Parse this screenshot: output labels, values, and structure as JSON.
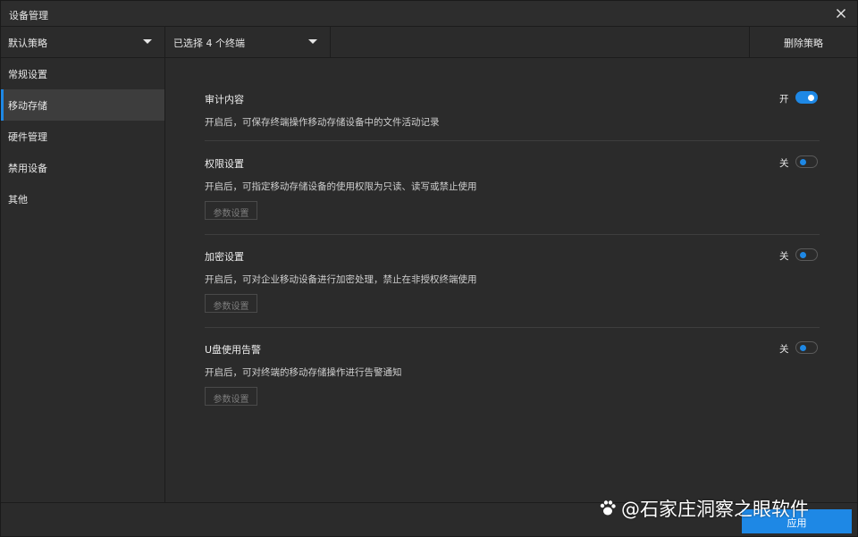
{
  "window": {
    "title": "设备管理",
    "close_icon": "close-icon"
  },
  "toolbar": {
    "policy_select": "默认策略",
    "terminal_select": "已选择 4 个终端",
    "delete_label": "删除策略"
  },
  "sidebar": {
    "items": [
      {
        "label": "常规设置",
        "active": false
      },
      {
        "label": "移动存储",
        "active": true
      },
      {
        "label": "硬件管理",
        "active": false
      },
      {
        "label": "禁用设备",
        "active": false
      },
      {
        "label": "其他",
        "active": false
      }
    ]
  },
  "sections": [
    {
      "title": "审计内容",
      "desc": "开启后，可保存终端操作移动存储设备中的文件活动记录",
      "toggle_label": "开",
      "toggle_on": true
    },
    {
      "title": "权限设置",
      "desc": "开启后，可指定移动存储设备的使用权限为只读、读写或禁止使用",
      "toggle_label": "关",
      "toggle_on": false,
      "param_label": "参数设置"
    },
    {
      "title": "加密设置",
      "desc": "开启后，可对企业移动设备进行加密处理，禁止在非授权终端使用",
      "toggle_label": "关",
      "toggle_on": false,
      "param_label": "参数设置"
    },
    {
      "title": "U盘使用告警",
      "desc": "开启后，可对终端的移动存储操作进行告警通知",
      "toggle_label": "关",
      "toggle_on": false,
      "param_label": "参数设置"
    }
  ],
  "footer": {
    "apply_label": "应用"
  },
  "watermark": {
    "text": "@石家庄洞察之眼软件"
  },
  "colors": {
    "accent": "#1e88e5",
    "background": "#2b2b2b"
  }
}
